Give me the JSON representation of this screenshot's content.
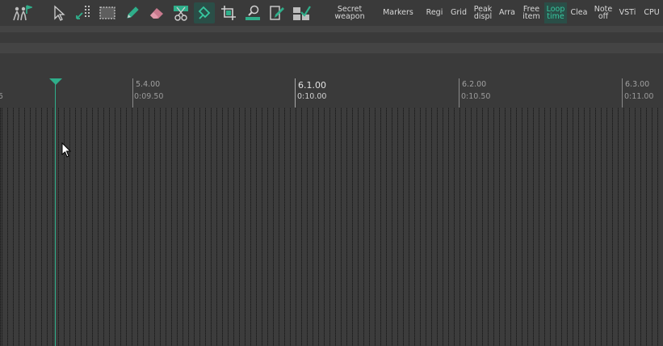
{
  "toolbar": {
    "icons": [
      {
        "name": "typing-keyboard-icon"
      },
      {
        "name": "select-arrow-icon"
      },
      {
        "name": "group-icon"
      },
      {
        "name": "rect-select-icon"
      },
      {
        "name": "pencil-icon"
      },
      {
        "name": "eraser-icon"
      },
      {
        "name": "slice-icon"
      },
      {
        "name": "paint-icon"
      },
      {
        "name": "crop-icon"
      },
      {
        "name": "zoom-icon"
      },
      {
        "name": "edit-icon"
      },
      {
        "name": "select-all-icon"
      }
    ],
    "buttons": {
      "secret_weapon": "Secret\nweapon",
      "markers": "Markers",
      "regions": "Regi",
      "grid": "Grid",
      "peak_display": "Peak\ndispl",
      "arrange": "Arra",
      "free_item": "Free\nitem",
      "loop_time": "Loop\ntime",
      "clear": "Clea",
      "note_off": "Note\noff",
      "vsti": "VSTi",
      "cpu": "CPU"
    },
    "accent_color": "#2fae8a"
  },
  "ruler": {
    "left_partial": "5",
    "markers": [
      {
        "bar": "5.4.00",
        "time": "0:09.50",
        "major": false
      },
      {
        "bar": "6.1.00",
        "time": "0:10.00",
        "major": true
      },
      {
        "bar": "6.2.00",
        "time": "0:10.50",
        "major": false
      },
      {
        "bar": "6.3.00",
        "time": "0:11.00",
        "major": false
      }
    ]
  }
}
